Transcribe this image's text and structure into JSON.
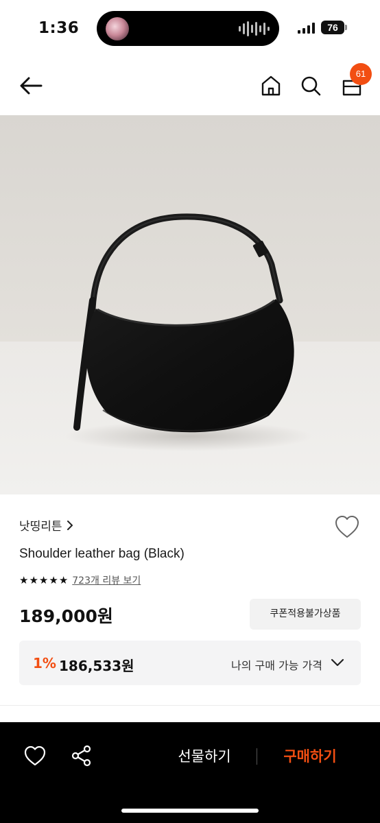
{
  "status_bar": {
    "time": "1:36",
    "battery": "76"
  },
  "header": {
    "cart_count": "61"
  },
  "product": {
    "brand": "낫띵리튼",
    "title": "Shoulder leather bag (Black)",
    "rating_stars": 5,
    "review_link": "723개 리뷰 보기",
    "price": "189,000원",
    "coupon_label": "쿠폰적용불가상품",
    "my_price_percent": "1%",
    "my_price": "186,533원",
    "my_price_label": "나의 구매 가능 가격"
  },
  "bottom_bar": {
    "gift_label": "선물하기",
    "buy_label": "구매하기"
  },
  "colors": {
    "accent": "#f24e12",
    "bar": "#000000"
  },
  "icons": [
    "back-arrow-icon",
    "home-icon",
    "search-icon",
    "cart-icon",
    "heart-icon",
    "share-icon",
    "chevron-down-icon",
    "star-icon"
  ]
}
